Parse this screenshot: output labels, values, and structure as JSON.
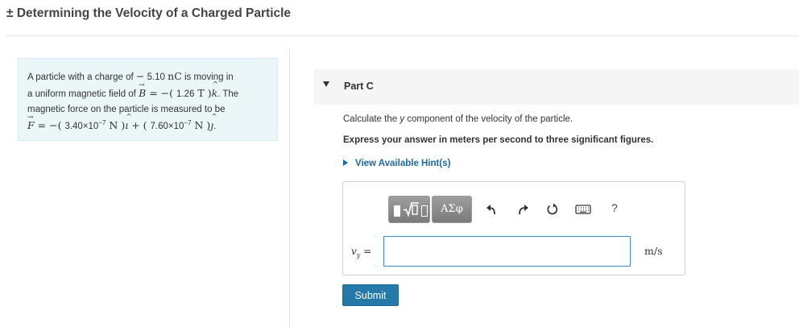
{
  "header": {
    "title": "± Determining the Velocity of a Charged Particle"
  },
  "problem": {
    "t1": "A particle with a charge of ",
    "charge_minus": "−",
    "charge_value": " 5.10 ",
    "charge_unit": "nC",
    "t2": " is moving in",
    "t3": "a uniform magnetic field of ",
    "b_sym": "B",
    "b_eq": " = −( ",
    "b_value": "1.26",
    "b_unit": " T )",
    "b_dir": "k",
    "t4": ". The",
    "t5": "magnetic force on the particle is measured to be",
    "f_sym": "F",
    "f_eq": " = −( ",
    "f1_base": "3.40×10",
    "f1_exp": "−7",
    "f1_unit": " N )",
    "f1_dir": "ı",
    "f_plus": " + ( ",
    "f2_base": "7.60×10",
    "f2_exp": "−7",
    "f2_unit": " N )",
    "f2_dir": "ȷ",
    "t6": "."
  },
  "part": {
    "label": "Part C",
    "question_pre": "Calculate the ",
    "question_var": "y",
    "question_post": " component of the velocity of the particle.",
    "instruction": "Express your answer in meters per second to three significant figures.",
    "hint_label": "View Available Hint(s)"
  },
  "toolbar": {
    "templates_icon": "templates-icon",
    "greek_label": "ΑΣφ",
    "undo_icon": "undo-icon",
    "redo_icon": "redo-icon",
    "reset_icon": "reset-icon",
    "keyboard_icon": "keyboard-icon",
    "help_label": "?"
  },
  "answer": {
    "var_main": "v",
    "var_sub": "y",
    "var_eq": " =",
    "value": "",
    "unit": "m/s"
  },
  "submit_label": "Submit",
  "colors": {
    "accent": "#2579a8",
    "link": "#1a6aa5",
    "problem_bg": "#eaf6f7",
    "input_border": "#3b8ec5"
  }
}
